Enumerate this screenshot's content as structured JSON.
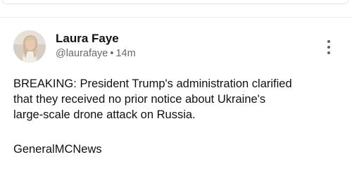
{
  "post": {
    "author_name": "Laura Faye",
    "handle": "@laurafaye",
    "separator": "•",
    "time_ago": "14m",
    "body": "BREAKING: President Trump's administration clarified\nthat they received no prior notice about Ukraine's\nlarge-scale drone attack on Russia.",
    "source_tag": "GeneralMCNews",
    "more_icon": "more-vertical-icon"
  },
  "colors": {
    "text_primary": "#111111",
    "text_secondary": "#666a70",
    "icon": "#5f6368",
    "divider": "#e8e9eb"
  }
}
